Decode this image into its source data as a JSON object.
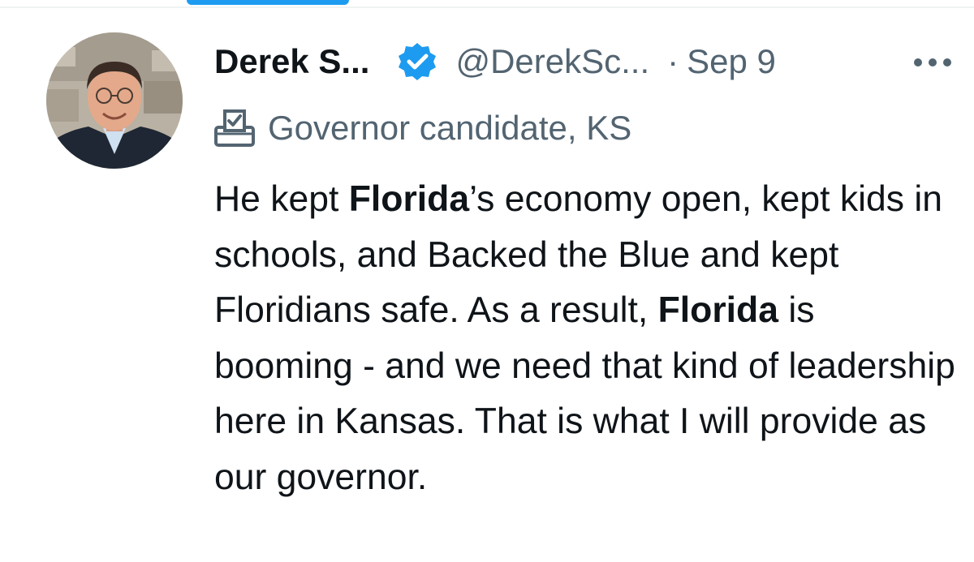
{
  "tweet": {
    "author": {
      "display_name": "Derek S...",
      "handle": "@DerekSc...",
      "verified": true,
      "avatar": "profile-photo"
    },
    "separator": "·",
    "date": "Sep 9",
    "more_icon": "ellipsis-icon",
    "affiliation": {
      "icon": "ballot-box-icon",
      "label": "Governor candidate, KS"
    },
    "body": [
      {
        "text": "He kept ",
        "bold": false
      },
      {
        "text": "Florida",
        "bold": true
      },
      {
        "text": "’s economy open, kept kids in schools, and Backed the Blue and kept Floridians safe. As a result, ",
        "bold": false
      },
      {
        "text": "Florida",
        "bold": true
      },
      {
        "text": " is booming - and we need that kind of leadership here in Kansas. That is what I will provide as our governor.",
        "bold": false
      }
    ]
  },
  "colors": {
    "text_primary": "#0f1419",
    "text_secondary": "#536471",
    "verified_blue": "#1d9bf0",
    "divider": "#eff3f4"
  }
}
